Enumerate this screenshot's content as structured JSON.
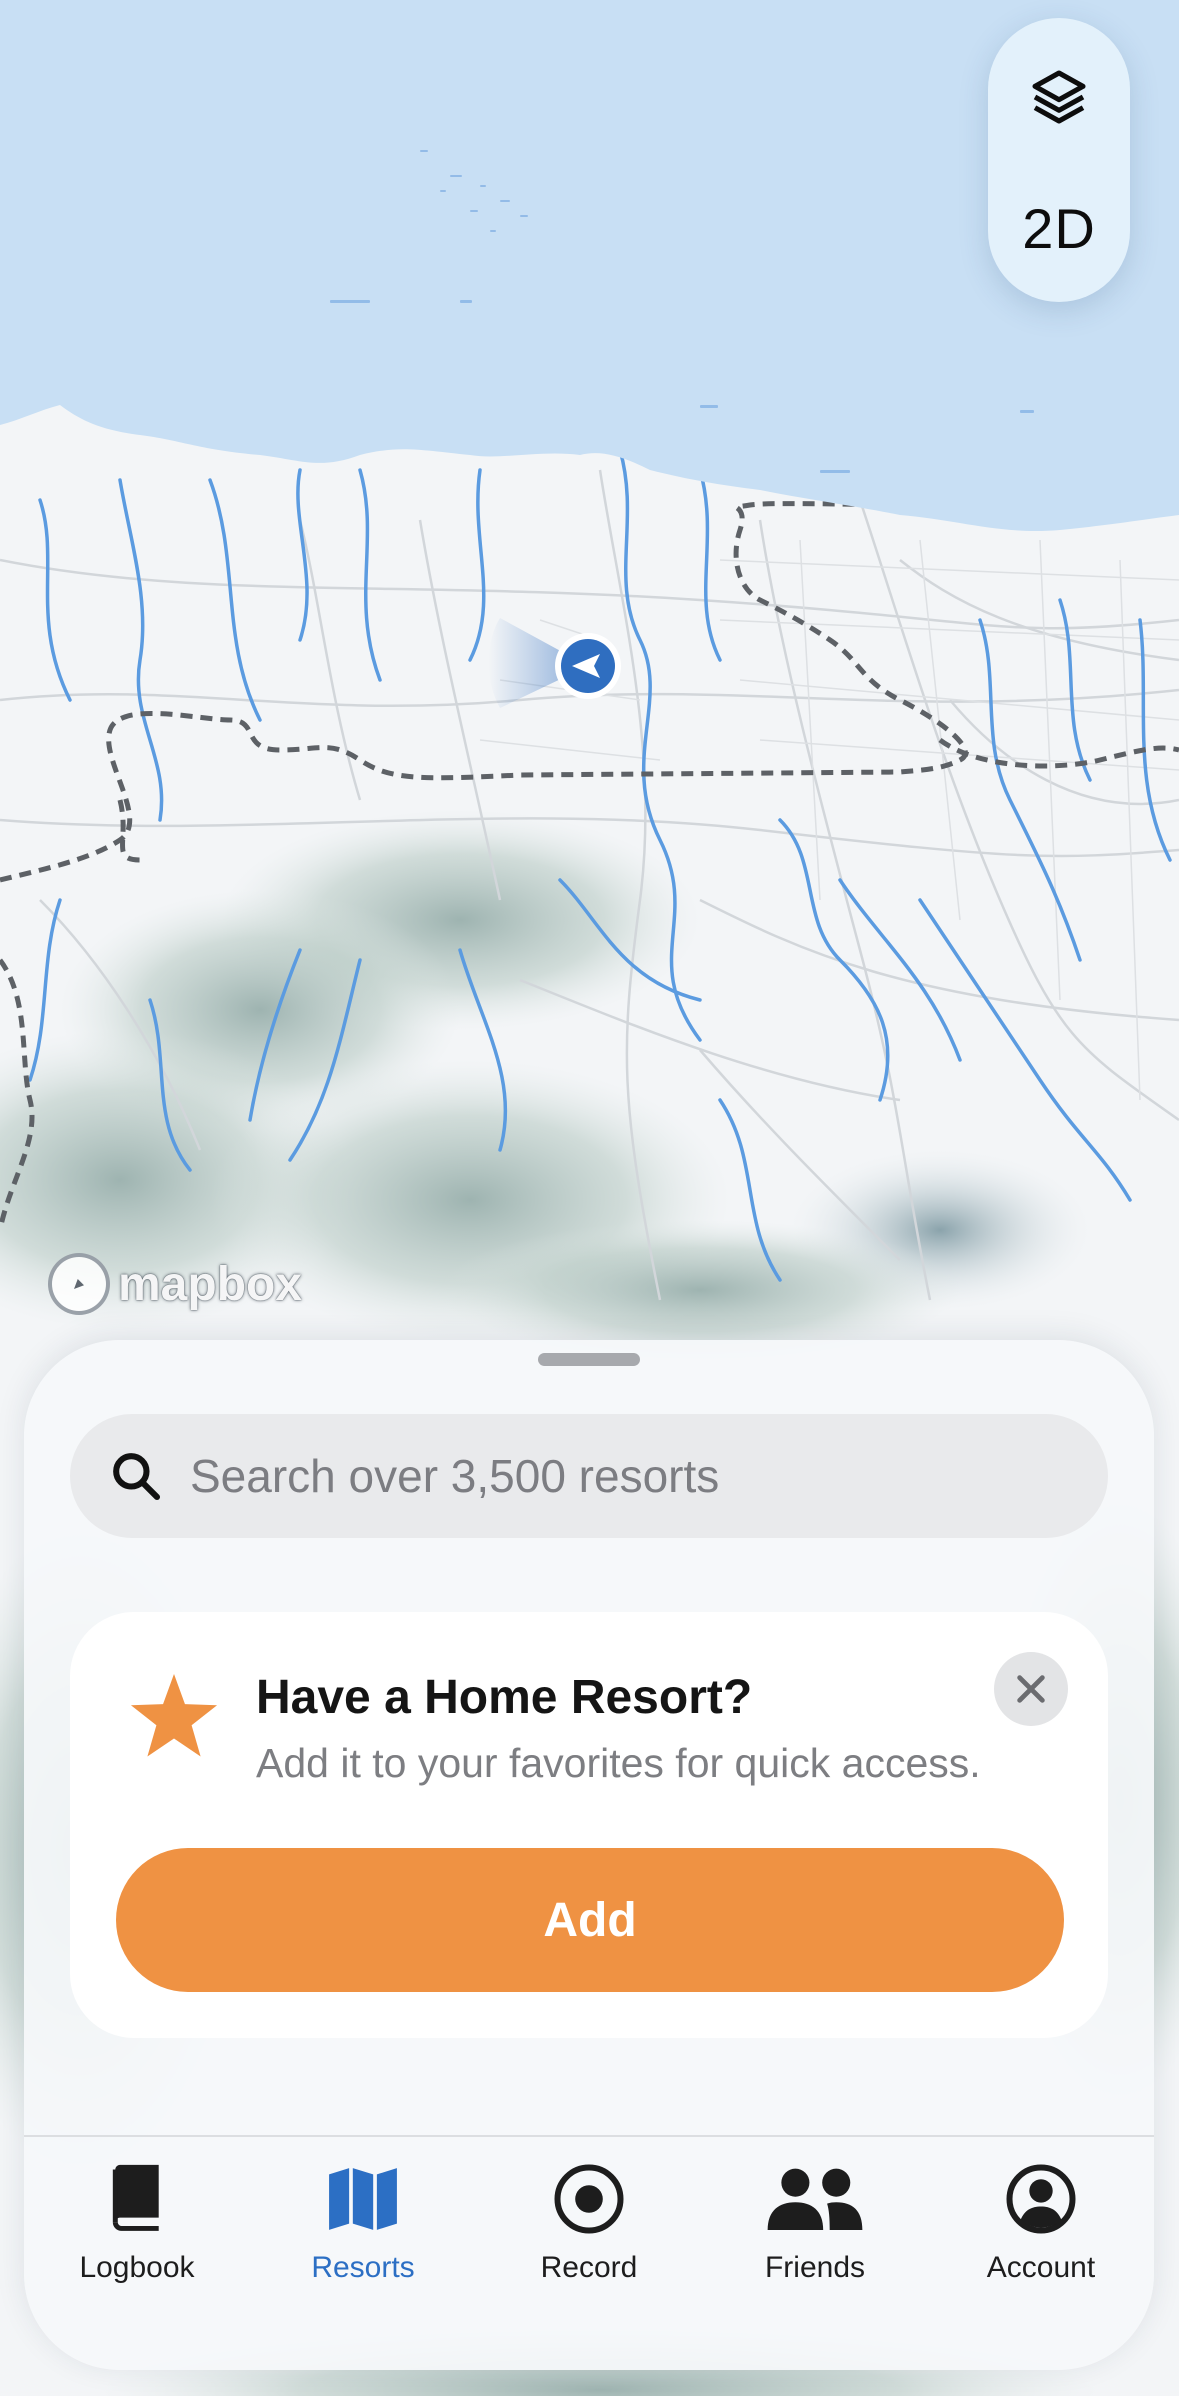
{
  "map": {
    "mode_label": "2D",
    "attribution": "mapbox"
  },
  "search": {
    "placeholder": "Search over 3,500 resorts"
  },
  "promo": {
    "title": "Have a Home Resort?",
    "subtitle": "Add it to your favorites for quick access.",
    "button_label": "Add"
  },
  "tabs": [
    {
      "label": "Logbook",
      "icon": "book-icon",
      "active": false
    },
    {
      "label": "Resorts",
      "icon": "map-icon",
      "active": true
    },
    {
      "label": "Record",
      "icon": "record-icon",
      "active": false
    },
    {
      "label": "Friends",
      "icon": "friends-icon",
      "active": false
    },
    {
      "label": "Account",
      "icon": "account-icon",
      "active": false
    }
  ],
  "colors": {
    "accent": "#ef9243",
    "active_tab": "#2c6fc4",
    "water": "#c8dff4",
    "location_dot": "#2f6ec0"
  }
}
